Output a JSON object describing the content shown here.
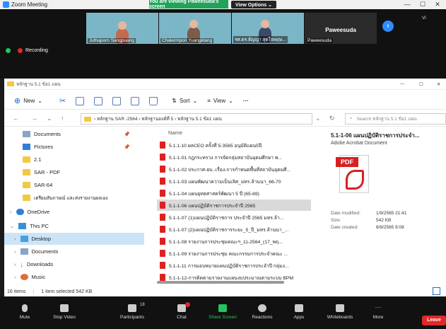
{
  "zoom": {
    "window_title": "Zoom Meeting",
    "banner": "You are viewing Paweesuda's screen",
    "view_options": "View Options ⌄",
    "view_corner": "Vi",
    "recording": "Recording",
    "participants": [
      {
        "name": "Juthaporn Sangpuang"
      },
      {
        "name": "Chalermpon Yuangklang"
      },
      {
        "name": "รศ.ดร.ธัญญา  สุดใจพฤษ..."
      },
      {
        "name": "Paweesuda",
        "sub": "Paweesuda"
      }
    ],
    "toolbar": [
      {
        "label": "Mute"
      },
      {
        "label": "Stop Video"
      },
      {
        "label": "Participants",
        "badge": "18"
      },
      {
        "label": "Chat"
      },
      {
        "label": "Share Screen"
      },
      {
        "label": "Reactions"
      },
      {
        "label": "Apps"
      },
      {
        "label": "Whiteboards"
      },
      {
        "label": "More"
      }
    ],
    "leave": "Leave",
    "accent": "#2d8cff",
    "share_green": "#22c55e"
  },
  "explorer": {
    "title": "หลักฐาน 5.1 ข้อ1 แผน",
    "toolbar": {
      "new": "New",
      "sort": "Sort",
      "view": "View",
      "more": "···"
    },
    "address": [
      "หลักฐาน SAR -2564",
      "หลักฐานองค์ที่ 5",
      "หลักฐาน 5.1 ข้อ1 แผน"
    ],
    "search_placeholder": "Search หลักฐาน 5.1 ข้อ1 แผน",
    "nav": [
      {
        "label": "Documents",
        "pinned": true
      },
      {
        "label": "Pictures",
        "pinned": true
      },
      {
        "label": "2.1"
      },
      {
        "label": "SAR - PDF"
      },
      {
        "label": "SAR-64"
      },
      {
        "label": "เตรียมสัมภาษณ์ และส่งรายงานผลเอง"
      },
      {
        "label": "OneDrive"
      },
      {
        "label": "This PC"
      },
      {
        "label": "Desktop",
        "selected": true
      },
      {
        "label": "Documents"
      },
      {
        "label": "Downloads"
      },
      {
        "label": "Music"
      }
    ],
    "column_name": "Name",
    "files": [
      {
        "name": "5.1.1-10 ผลCEO ครั้งที่ 5-3565 อนุมัติแผน5ปี"
      },
      {
        "name": "5.1-1-01 กฎกระทรวง การจัดกลุ่มสถาบันอุดมศึกษา พ..."
      },
      {
        "name": "5.1-1-02 ประกาศ-ยบ.-เรื่อง-การกำหนดพื้นที่สถาบันอุดมศึ..."
      },
      {
        "name": "5.1-1-03 แผนพัฒนาความเป็นเลิศ_มทร.ล้านนา_66-70"
      },
      {
        "name": "5.1-1-04 แผนยุทธศาสตร์พัฒนา 5 ปี (65-69)"
      },
      {
        "name": "5.1-1-06 แผนปฏิบัติราชการประจำปี 2565",
        "selected": true
      },
      {
        "name": "5.1-1-07 (1)แผนปฏิบัติราชการ ประจำปี 2565 มทร.ล้า..."
      },
      {
        "name": "5.1-1-07 (2)แผนปฏิบัติราชการระยะ_5_ปี_มทร.ล้านนา_..."
      },
      {
        "name": "5.1-1-08 รายงานการประชุมคณะฯ_11-2564_(17_พฤ..."
      },
      {
        "name": "5.1-1-09 รายงานการประชุม คณะกรรมการประจำคณะ ..."
      },
      {
        "name": "5.1-1-11 การมอบหมายแผนปฏิบัติราชการประจำปี กลุ่มง..."
      },
      {
        "name": "5.1-1-12-การติดตามรายงานแผนงบประมาณตามระบบ BPM"
      }
    ],
    "preview": {
      "title": "5.1-1-06 แผนปฏิบัติราชการประจำ...",
      "type": "Adobe Acrobat Document",
      "icon_label": "PDF",
      "date_modified_label": "Date modified:",
      "date_modified": "1/9/2565 21:41",
      "size_label": "Size:",
      "size": "542 KB",
      "date_created_label": "Date created:",
      "date_created": "8/9/2565 8:08"
    },
    "status": {
      "items": "16 items",
      "selected": "1 item selected  542 KB"
    }
  }
}
